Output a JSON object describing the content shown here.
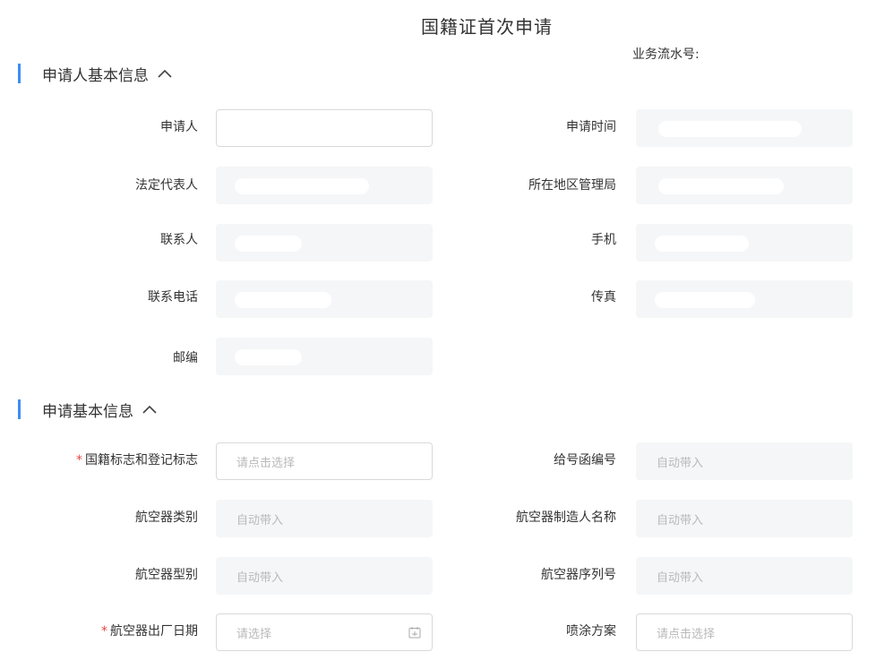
{
  "page": {
    "title": "国籍证首次申请",
    "serial_label": "业务流水号:"
  },
  "sections": {
    "applicant": {
      "title": "申请人基本信息"
    },
    "application": {
      "title": "申请基本信息"
    }
  },
  "applicant_fields": {
    "applicant": {
      "label": "申请人",
      "value": ""
    },
    "apply_time": {
      "label": "申请时间"
    },
    "legal_rep": {
      "label": "法定代表人"
    },
    "local_bureau": {
      "label": "所在地区管理局"
    },
    "contact": {
      "label": "联系人"
    },
    "mobile": {
      "label": "手机"
    },
    "phone": {
      "label": "联系电话"
    },
    "fax": {
      "label": "传真"
    },
    "postcode": {
      "label": "邮编"
    }
  },
  "application_fields": {
    "nationality_mark": {
      "label": "国籍标志和登记标志",
      "required": "*",
      "placeholder": "请点击选择"
    },
    "letter_no": {
      "label": "给号函编号",
      "placeholder": "自动带入"
    },
    "aircraft_category": {
      "label": "航空器类别",
      "placeholder": "自动带入"
    },
    "manufacturer": {
      "label": "航空器制造人名称",
      "placeholder": "自动带入"
    },
    "aircraft_model": {
      "label": "航空器型别",
      "placeholder": "自动带入"
    },
    "serial_no": {
      "label": "航空器序列号",
      "placeholder": "自动带入"
    },
    "factory_date": {
      "label": "航空器出厂日期",
      "required": "*",
      "placeholder": "请选择"
    },
    "paint_scheme": {
      "label": "喷涂方案",
      "placeholder": "请点击选择"
    }
  },
  "icons": {
    "section_toggle": "chevron-up-icon",
    "date_picker": "calendar-icon"
  },
  "colors": {
    "accent": "#3d8ef0",
    "required": "#e84545",
    "readonly_bg": "#f5f6f7",
    "placeholder": "#b9b9b9"
  }
}
